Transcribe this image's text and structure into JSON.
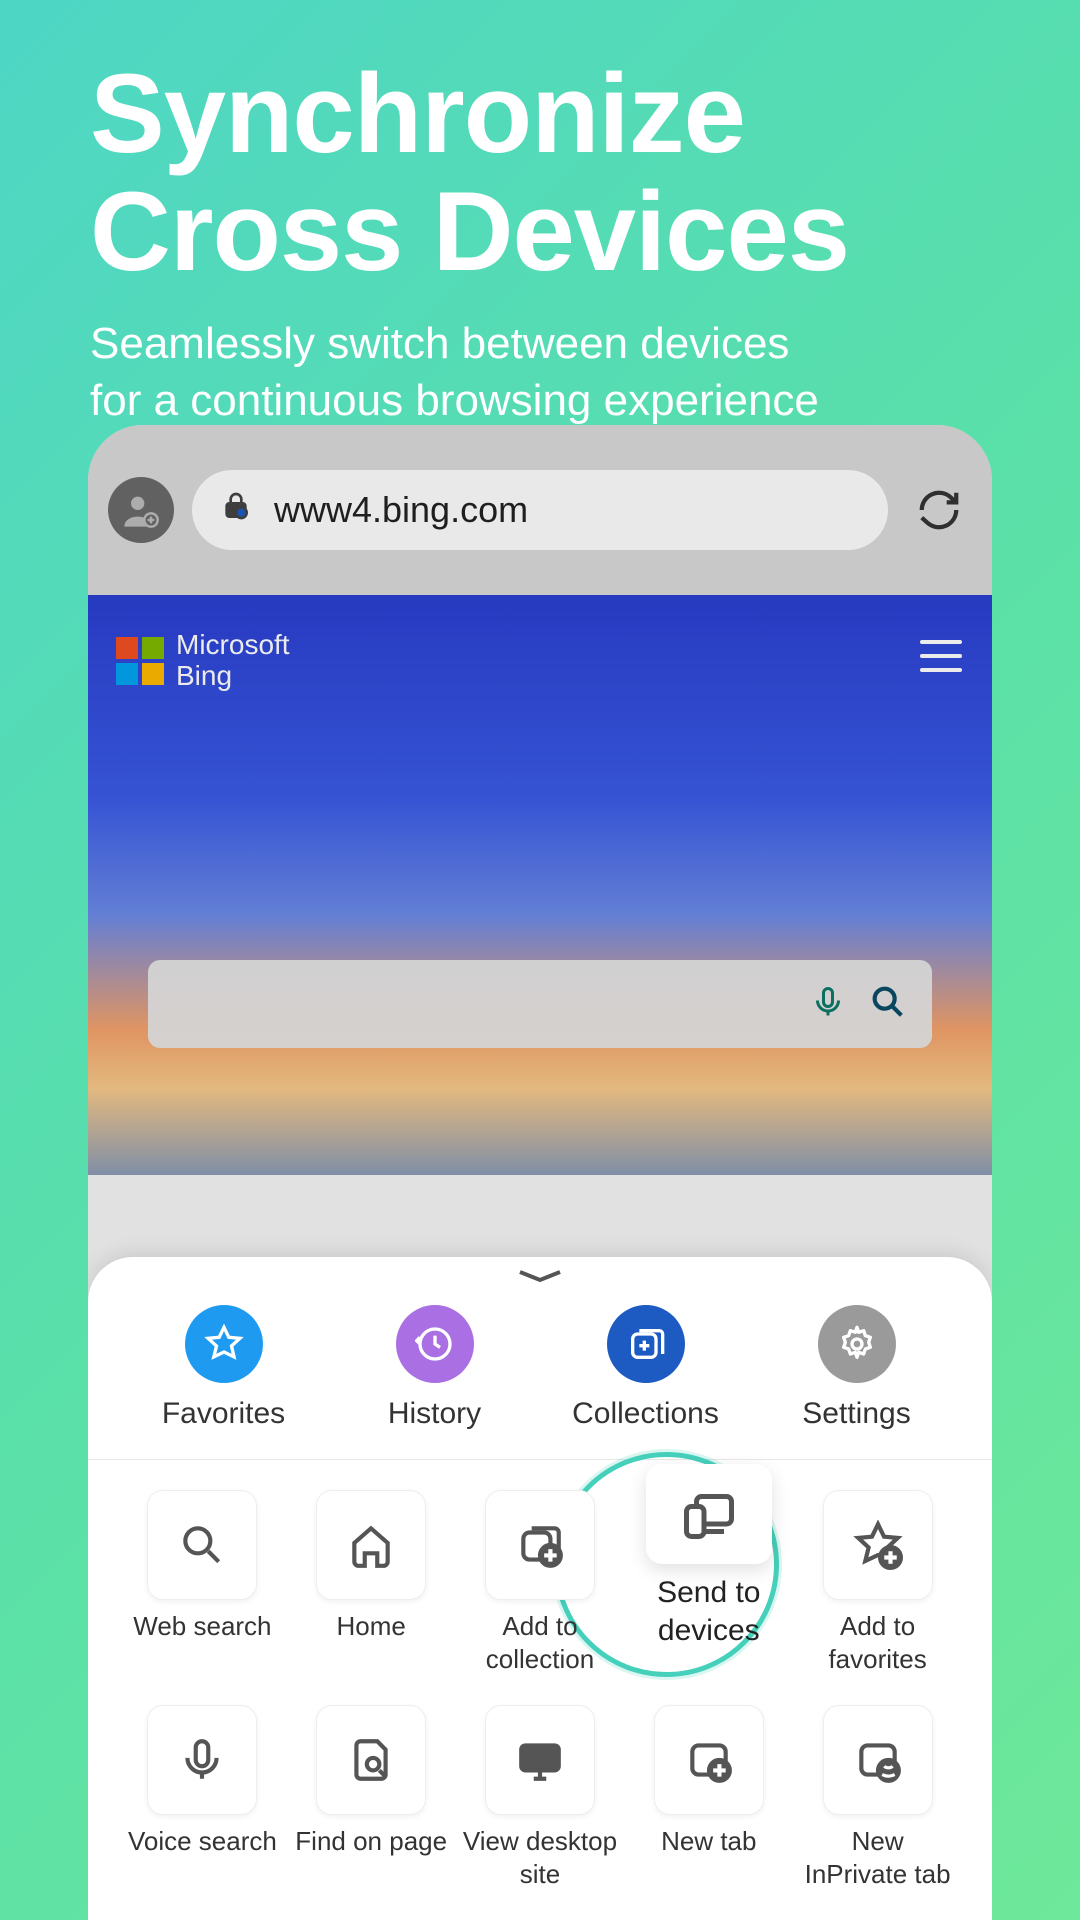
{
  "hero": {
    "title_line1": "Synchronize",
    "title_line2": "Cross Devices",
    "subtitle_line1": "Seamlessly switch between devices",
    "subtitle_line2": "for a continuous browsing experience"
  },
  "address_bar": {
    "url": "www4.bing.com"
  },
  "bing": {
    "label_line1": "Microsoft",
    "label_line2": "Bing"
  },
  "quickrow": [
    {
      "label": "Favorites",
      "color": "q-blue",
      "icon": "star"
    },
    {
      "label": "History",
      "color": "q-purple",
      "icon": "history"
    },
    {
      "label": "Collections",
      "color": "q-deepblue",
      "icon": "collections"
    },
    {
      "label": "Settings",
      "color": "q-gray",
      "icon": "gear"
    }
  ],
  "grid_row1": [
    {
      "label": "Web search",
      "icon": "search"
    },
    {
      "label": "Home",
      "icon": "home"
    },
    {
      "label": "Add to collection",
      "icon": "add-collection"
    },
    {
      "label": "Send to devices",
      "icon": "send-devices",
      "highlight": true
    },
    {
      "label": "Add to favorites",
      "icon": "add-favorite"
    }
  ],
  "grid_row2": [
    {
      "label": "Voice search",
      "icon": "mic"
    },
    {
      "label": "Find on page",
      "icon": "find"
    },
    {
      "label": "View desktop site",
      "icon": "desktop"
    },
    {
      "label": "New tab",
      "icon": "new-tab"
    },
    {
      "label": "New InPrivate tab",
      "icon": "inprivate"
    }
  ]
}
